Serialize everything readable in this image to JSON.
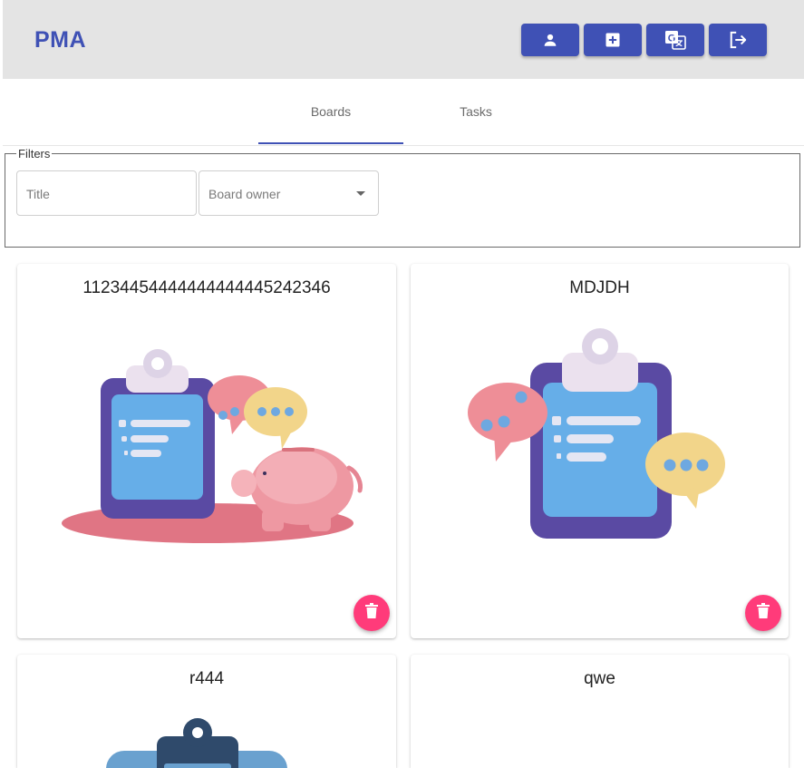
{
  "app": {
    "logo": "PMA"
  },
  "header": {
    "buttons": [
      {
        "icon": "person-icon"
      },
      {
        "icon": "add-box-icon"
      },
      {
        "icon": "translate-icon"
      },
      {
        "icon": "logout-icon"
      }
    ]
  },
  "tabs": [
    {
      "label": "Boards",
      "active": true
    },
    {
      "label": "Tasks",
      "active": false
    }
  ],
  "filters": {
    "legend": "Filters",
    "title_placeholder": "Title",
    "owner_placeholder": "Board owner"
  },
  "boards": [
    {
      "title": "11234454444444444445242346",
      "image": "clipboard-piggy-bank-illustration"
    },
    {
      "title": "MDJDH",
      "image": "clipboard-chat-bubbles-illustration"
    },
    {
      "title": "r444",
      "image": "clipboard-blue-illustration"
    },
    {
      "title": "qwe",
      "image": ""
    }
  ],
  "colors": {
    "primary": "#3f51b5",
    "accent": "#ff3b7a",
    "header_bg": "#e4e4e4"
  }
}
